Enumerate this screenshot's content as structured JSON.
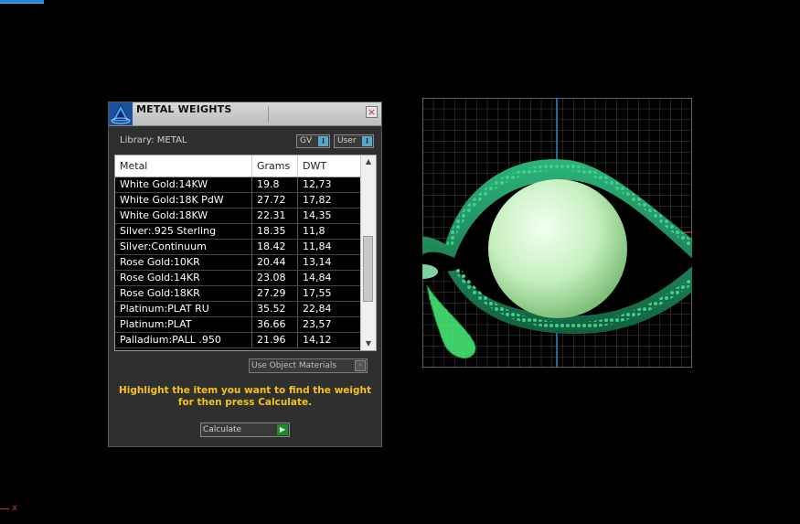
{
  "panel": {
    "title": "METAL WEIGHTS",
    "library_label": "Library: METAL",
    "gv_label": "GV",
    "user_label": "User",
    "close_glyph": "×",
    "table": {
      "headers": [
        "Metal",
        "Grams",
        "DWT"
      ],
      "rows": [
        [
          "White Gold:14KW",
          "19.8",
          "12,73"
        ],
        [
          "White Gold:18K PdW",
          "27.72",
          "17,82"
        ],
        [
          "White Gold:18KW",
          "22.31",
          "14,35"
        ],
        [
          "Silver:.925 Sterling",
          "18.35",
          "11,8"
        ],
        [
          "Silver:Continuum",
          "18.42",
          "11,84"
        ],
        [
          "Rose Gold:10KR",
          "20.44",
          "13,14"
        ],
        [
          "Rose Gold:14KR",
          "23.08",
          "14,84"
        ],
        [
          "Rose Gold:18KR",
          "27.29",
          "17,55"
        ],
        [
          "Platinum:PLAT RU",
          "35.52",
          "22,84"
        ],
        [
          "Platinum:PLAT",
          "36.66",
          "23,57"
        ],
        [
          "Palladium:PALL .950",
          "21.96",
          "14,12"
        ]
      ]
    },
    "use_object_materials_label": "Use Object Materials",
    "hint_line1": "Highlight the item you want to find the weight",
    "hint_line2": "for then press Calculate.",
    "calculate_label": "Calculate"
  },
  "axis_label": "x",
  "colors": {
    "panel_bg": "#2f2f2f",
    "hint": "#f3c21a",
    "model_green": "#1f8a5a",
    "pearl": "#c9f5c4",
    "grid": "#8a8a8a"
  },
  "icons": {
    "logo": "app-logo-icon",
    "close": "close-icon",
    "dropdown": "dropdown-icon",
    "go": "play-arrow-icon"
  }
}
